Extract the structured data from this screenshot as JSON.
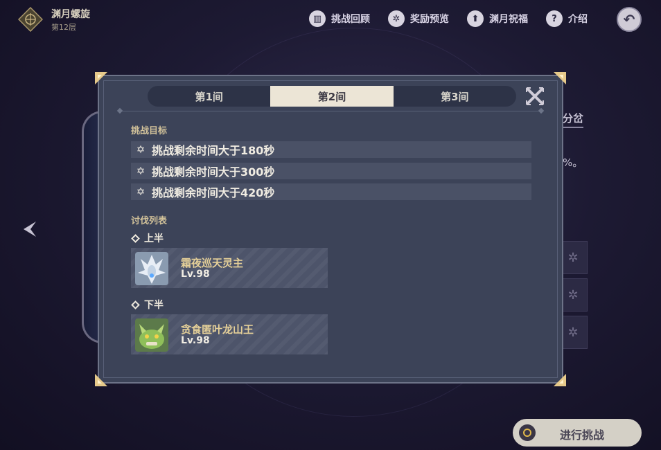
{
  "header": {
    "title": "渊月螺旋",
    "subtitle": "第12层",
    "nav": [
      {
        "label": "挑战回顾",
        "icon": "book-icon"
      },
      {
        "label": "奖励预览",
        "icon": "star-badge-icon"
      },
      {
        "label": "渊月祝福",
        "icon": "up-arrow-icon"
      },
      {
        "label": "介绍",
        "icon": "question-icon"
      }
    ]
  },
  "background": {
    "tab_text": "分岔",
    "pct_text": "%。"
  },
  "modal": {
    "tabs": [
      {
        "label": "第1间",
        "active": false
      },
      {
        "label": "第2间",
        "active": true
      },
      {
        "label": "第3间",
        "active": false
      }
    ],
    "goals_label": "挑战目标",
    "goals": [
      "挑战剩余时间大于180秒",
      "挑战剩余时间大于300秒",
      "挑战剩余时间大于420秒"
    ],
    "enemies_label": "讨伐列表",
    "halves": [
      {
        "label": "上半",
        "enemy": {
          "name": "霜夜巡天灵主",
          "level": "Lv.98"
        }
      },
      {
        "label": "下半",
        "enemy": {
          "name": "贪食匿叶龙山王",
          "level": "Lv.98"
        }
      }
    ]
  },
  "start_button": {
    "label": "进行挑战"
  },
  "colors": {
    "modal_bg": "#3c4358",
    "tab_active_bg": "#ece5d6",
    "section_label": "#d2c29a",
    "enemy_name": "#e4cf98"
  }
}
